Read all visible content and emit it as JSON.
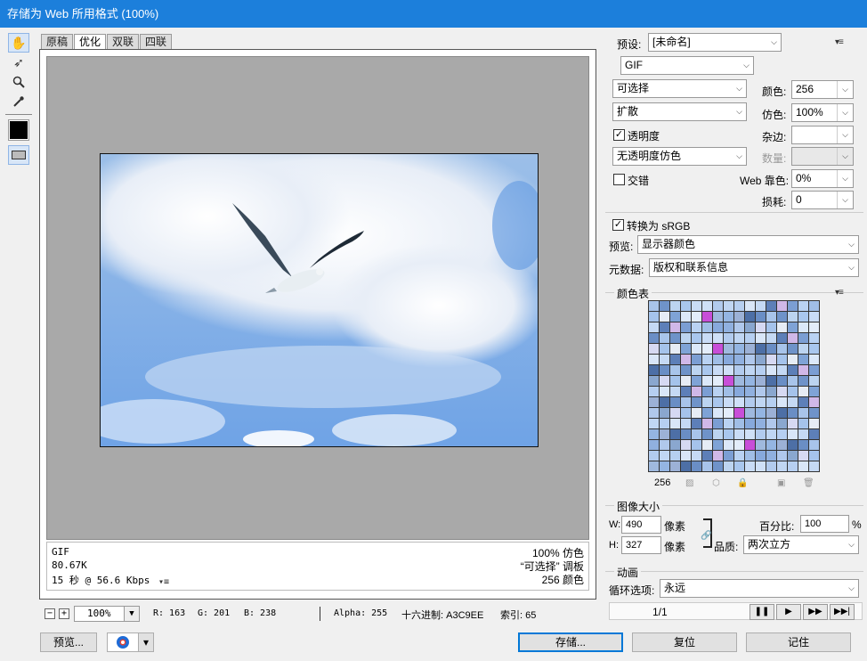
{
  "window": {
    "title": "存储为 Web 所用格式 (100%)"
  },
  "tools": [
    {
      "name": "hand-tool-icon",
      "glyph": "✋"
    },
    {
      "name": "slice-select-tool-icon",
      "glyph": "➶"
    },
    {
      "name": "zoom-tool-icon",
      "glyph": "🔍"
    },
    {
      "name": "eyedropper-tool-icon",
      "glyph": "✎"
    }
  ],
  "tabs": [
    "原稿",
    "优化",
    "双联",
    "四联"
  ],
  "info": {
    "format": "GIF",
    "size": "80.67K",
    "time": "15 秒 @ 56.6 Kbps",
    "dither": "100% 仿色",
    "palette": "“可选择” 调板",
    "colors": "256 颜色"
  },
  "status": {
    "zoom": "100%",
    "r": "R: 163",
    "g": "G: 201",
    "b": "B: 238",
    "alpha": "Alpha: 255",
    "hex": "十六进制: A3C9EE",
    "index": "索引: 65"
  },
  "buttons": {
    "preview": "预览...",
    "save": "存储...",
    "reset": "复位",
    "remember": "记住"
  },
  "settings": {
    "preset_label": "预设:",
    "preset_value": "[未命名]",
    "format": "GIF",
    "reduction": "可选择",
    "dither_algo": "扩散",
    "transparency_label": "透明度",
    "matte_dither": "无透明度仿色",
    "interlaced_label": "交错",
    "colors_label": "颜色:",
    "colors_value": "256",
    "dither_label": "仿色:",
    "dither_value": "100%",
    "matte_label": "杂边:",
    "amount_label": "数量:",
    "web_snap_label": "Web 靠色:",
    "web_snap_value": "0%",
    "lossy_label": "损耗:",
    "lossy_value": "0",
    "convert_srgb_label": "转换为 sRGB",
    "preview_label": "预览:",
    "preview_value": "显示器颜色",
    "metadata_label": "元数据:",
    "metadata_value": "版权和联系信息",
    "transparency_checked": true,
    "interlaced_checked": false,
    "convert_srgb_checked": true
  },
  "color_table": {
    "title": "颜色表",
    "count": "256",
    "colors": [
      "#a8c4ea",
      "#7fa3d6",
      "#b9d2f2",
      "#cfe0f7",
      "#94b5e2",
      "#8aa7cf",
      "#c5d9f4",
      "#6f93c9",
      "#dbe8f9",
      "#a0bee6",
      "#b2cbee",
      "#9cb1d6",
      "#d6d9f2",
      "#5d7fb8",
      "#bcd4f0",
      "#e3edfa",
      "#87a9dc",
      "#c0d6f3",
      "#4d6fa6",
      "#a5c3eb",
      "#d0b8e8",
      "#a9c7ee",
      "#c84fd8",
      "#90b0df",
      "#b6cff1",
      "#6a8ec5",
      "#e6ecf5",
      "#7b9ed3",
      "#c9dcf6",
      "#9fb9de",
      "#b0c8ec",
      "#d9e6f8"
    ]
  },
  "image_size": {
    "title": "图像大小",
    "w_label": "W:",
    "w_value": "490",
    "h_label": "H:",
    "h_value": "327",
    "unit": "像素",
    "percent_label": "百分比:",
    "percent_value": "100",
    "percent_unit": "%",
    "quality_label": "品质:",
    "quality_value": "两次立方"
  },
  "animation": {
    "title": "动画",
    "loop_label": "循环选项:",
    "loop_value": "永远",
    "frame": "1/1"
  },
  "accent_color": "#1c7fdb"
}
